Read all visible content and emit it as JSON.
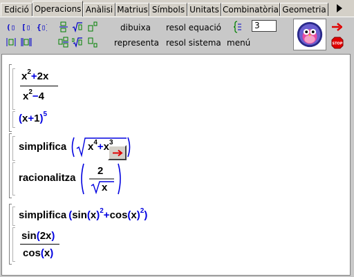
{
  "tabs": [
    {
      "label": "Edició",
      "active": false
    },
    {
      "label": "Operacions",
      "active": true
    },
    {
      "label": "Anàlisi",
      "active": false
    },
    {
      "label": "Matrius",
      "active": false
    },
    {
      "label": "Símbols",
      "active": false
    },
    {
      "label": "Unitats",
      "active": false
    },
    {
      "label": "Combinatòria",
      "active": false
    },
    {
      "label": "Geometria",
      "active": false
    }
  ],
  "toolbar": {
    "dibuixa": "dibuixa",
    "resol_equacio": "resol equació",
    "representa": "representa",
    "resol_sistema": "resol sistema",
    "menu": "menú",
    "precision_value": "3"
  },
  "expr1": {
    "num_a": "x",
    "num_a_exp": "2",
    "num_op": "+",
    "num_b": "2x",
    "den_a": "x",
    "den_a_exp": "2",
    "den_op": "−",
    "den_b": "4",
    "result_open": "(",
    "result_x": "x",
    "result_plus": "+",
    "result_one": "1",
    "result_close": ")",
    "result_exp": "5"
  },
  "expr2": {
    "func": "simplifica",
    "radicand_x1": "x",
    "exp1": "4",
    "plus": "+",
    "radicand_x2": "x",
    "exp2": "3",
    "func2": "racionalitza",
    "frac_num": "2",
    "frac_den_x": "x"
  },
  "expr3": {
    "func": "simplifica",
    "sin": "sin",
    "x1": "x",
    "exp_a": "2",
    "plus": "+",
    "cos": "cos",
    "x2": "x",
    "exp_b": "2",
    "res_num_sin": "sin",
    "res_num_arg": "2x",
    "res_den_cos": "cos",
    "res_den_arg": "x"
  },
  "colors": {
    "accent": "#0000e0",
    "arrow": "#e00000"
  }
}
